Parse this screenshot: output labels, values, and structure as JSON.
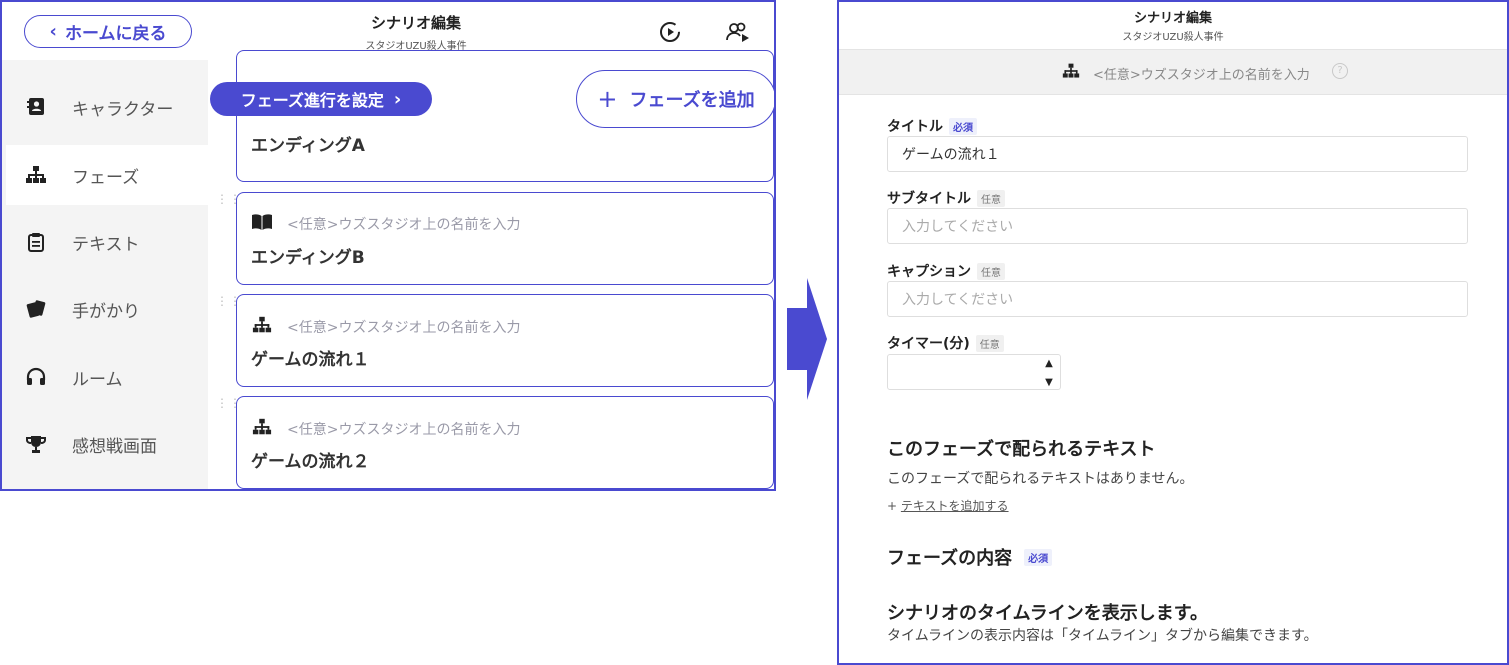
{
  "left": {
    "header": {
      "home_button": "ホームに戻る",
      "title": "シナリオ編集",
      "subtitle": "スタジオUZU殺人事件"
    },
    "sidebar": {
      "items": [
        {
          "label": "キャラクター",
          "icon": "contacts-book-icon"
        },
        {
          "label": "フェーズ",
          "icon": "sitemap-icon",
          "active": true
        },
        {
          "label": "テキスト",
          "icon": "clipboard-icon"
        },
        {
          "label": "手がかり",
          "icon": "cards-icon"
        },
        {
          "label": "ルーム",
          "icon": "headphones-icon"
        },
        {
          "label": "感想戦画面",
          "icon": "trophy-icon"
        }
      ]
    },
    "main": {
      "phase_progress_button": "フェーズ進行を設定",
      "add_phase_button": "フェーズを追加",
      "cards": [
        {
          "meta": "",
          "title": "エンディングA"
        },
        {
          "meta": "<任意>ウズスタジオ上の名前を入力",
          "title": "エンディングB",
          "icon": "book-icon"
        },
        {
          "meta": "<任意>ウズスタジオ上の名前を入力",
          "title": "ゲームの流れ１",
          "icon": "sitemap-icon"
        },
        {
          "meta": "<任意>ウズスタジオ上の名前を入力",
          "title": "ゲームの流れ２",
          "icon": "sitemap-icon"
        }
      ]
    }
  },
  "right": {
    "header": {
      "title": "シナリオ編集",
      "subtitle": "スタジオUZU殺人事件"
    },
    "name_bar": {
      "placeholder": "<任意>ウズスタジオ上の名前を入力",
      "help": "?"
    },
    "fields": {
      "title_label": "タイトル",
      "title_badge": "必須",
      "title_value": "ゲームの流れ１",
      "subtitle_label": "サブタイトル",
      "subtitle_badge": "任意",
      "subtitle_placeholder": "入力してください",
      "caption_label": "キャプション",
      "caption_badge": "任意",
      "caption_placeholder": "入力してください",
      "timer_label": "タイマー(分)",
      "timer_badge": "任意"
    },
    "text_section": {
      "heading": "このフェーズで配られるテキスト",
      "empty": "このフェーズで配られるテキストはありません。",
      "add_prefix": "+",
      "add_link": "テキストを追加する"
    },
    "content_section": {
      "heading": "フェーズの内容",
      "badge": "必須"
    },
    "timeline": {
      "heading": "シナリオのタイムラインを表示します。",
      "body": "タイムラインの表示内容は「タイムライン」タブから編集できます。"
    }
  },
  "colors": {
    "accent": "#4a4ad0",
    "sidebar_bg": "#f4f4f4"
  }
}
